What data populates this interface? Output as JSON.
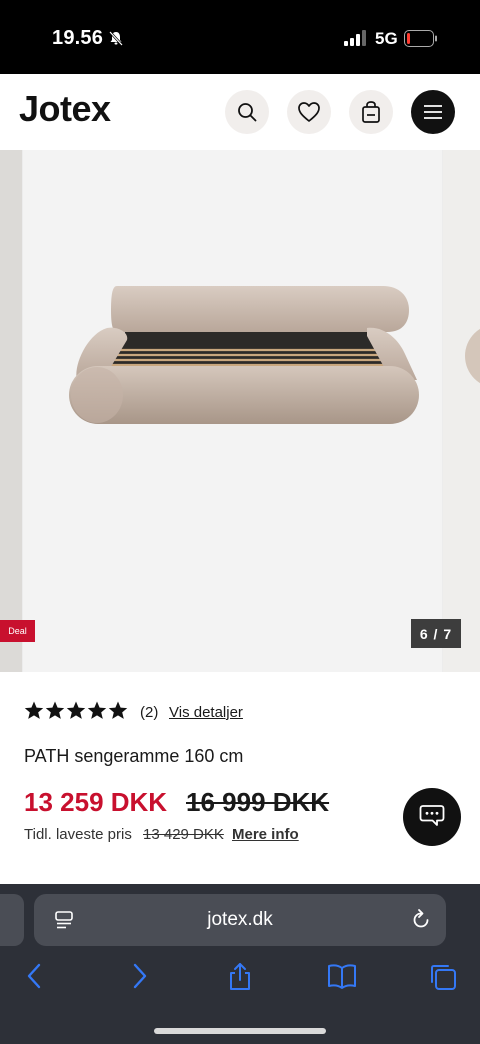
{
  "status_bar": {
    "time": "19.56",
    "network": "5G"
  },
  "header": {
    "logo": "Jotex",
    "icons": [
      "search-icon",
      "heart-icon",
      "bag-icon",
      "menu-icon"
    ]
  },
  "gallery": {
    "deal_badge": "Deal",
    "counter": "6 / 7",
    "current_image": 6,
    "total_images": 7
  },
  "product": {
    "rating_stars": 5,
    "review_count": "(2)",
    "details_link": "Vis detaljer",
    "name": "PATH sengeramme 160 cm",
    "price": "13 259 DKK",
    "old_price": "16 999 DKK",
    "lowest_label": "Tidl. laveste pris",
    "lowest_price": "13 429 DKK",
    "more_info_link": "Mere info"
  },
  "browser": {
    "url": "jotex.dk",
    "colors": {
      "accent": "#3478f6"
    }
  },
  "colors": {
    "sale": "#c8102e",
    "dark": "#111111"
  }
}
